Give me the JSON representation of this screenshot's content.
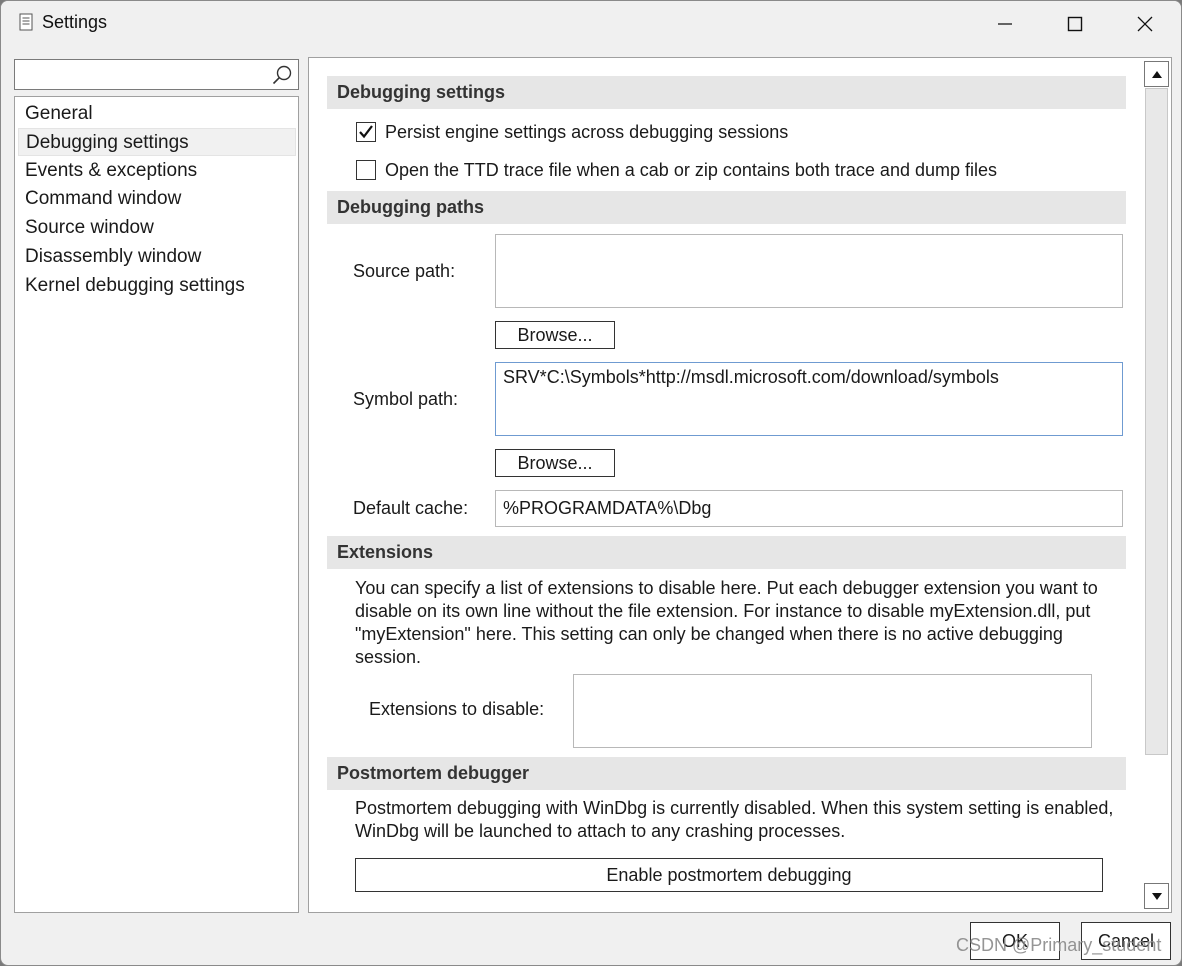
{
  "window": {
    "title": "Settings"
  },
  "search": {
    "value": "",
    "placeholder": ""
  },
  "sidebar": {
    "items": [
      {
        "label": "General"
      },
      {
        "label": "Debugging settings"
      },
      {
        "label": "Events & exceptions"
      },
      {
        "label": "Command window"
      },
      {
        "label": "Source window"
      },
      {
        "label": "Disassembly window"
      },
      {
        "label": "Kernel debugging settings"
      }
    ],
    "selected": "Debugging settings"
  },
  "debugging_settings": {
    "header": "Debugging settings",
    "persist_label": "Persist engine settings across debugging sessions",
    "persist_checked": true,
    "ttd_label": "Open the TTD trace file when a cab or zip contains both trace and dump files",
    "ttd_checked": false
  },
  "debugging_paths": {
    "header": "Debugging paths",
    "source_label": "Source path:",
    "source_value": "",
    "browse_label": "Browse...",
    "symbol_label": "Symbol path:",
    "symbol_value": "SRV*C:\\Symbols*http://msdl.microsoft.com/download/symbols",
    "cache_label": "Default cache:",
    "cache_value": "%PROGRAMDATA%\\Dbg"
  },
  "extensions": {
    "header": "Extensions",
    "description": "You can specify a list of extensions to disable here. Put each debugger extension you want to disable on its own line without the file extension. For instance to disable myExtension.dll, put \"myExtension\" here. This setting can only be changed when there is no active debugging session.",
    "disable_label": "Extensions to disable:",
    "disable_value": ""
  },
  "postmortem": {
    "header": "Postmortem debugger",
    "description": "Postmortem debugging with WinDbg is currently disabled. When this system setting is enabled, WinDbg will be launched to attach to any crashing processes.",
    "enable_label": "Enable postmortem debugging"
  },
  "footer": {
    "ok_label": "OK",
    "cancel_label": "Cancel"
  },
  "watermark": "CSDN @Primary_student"
}
